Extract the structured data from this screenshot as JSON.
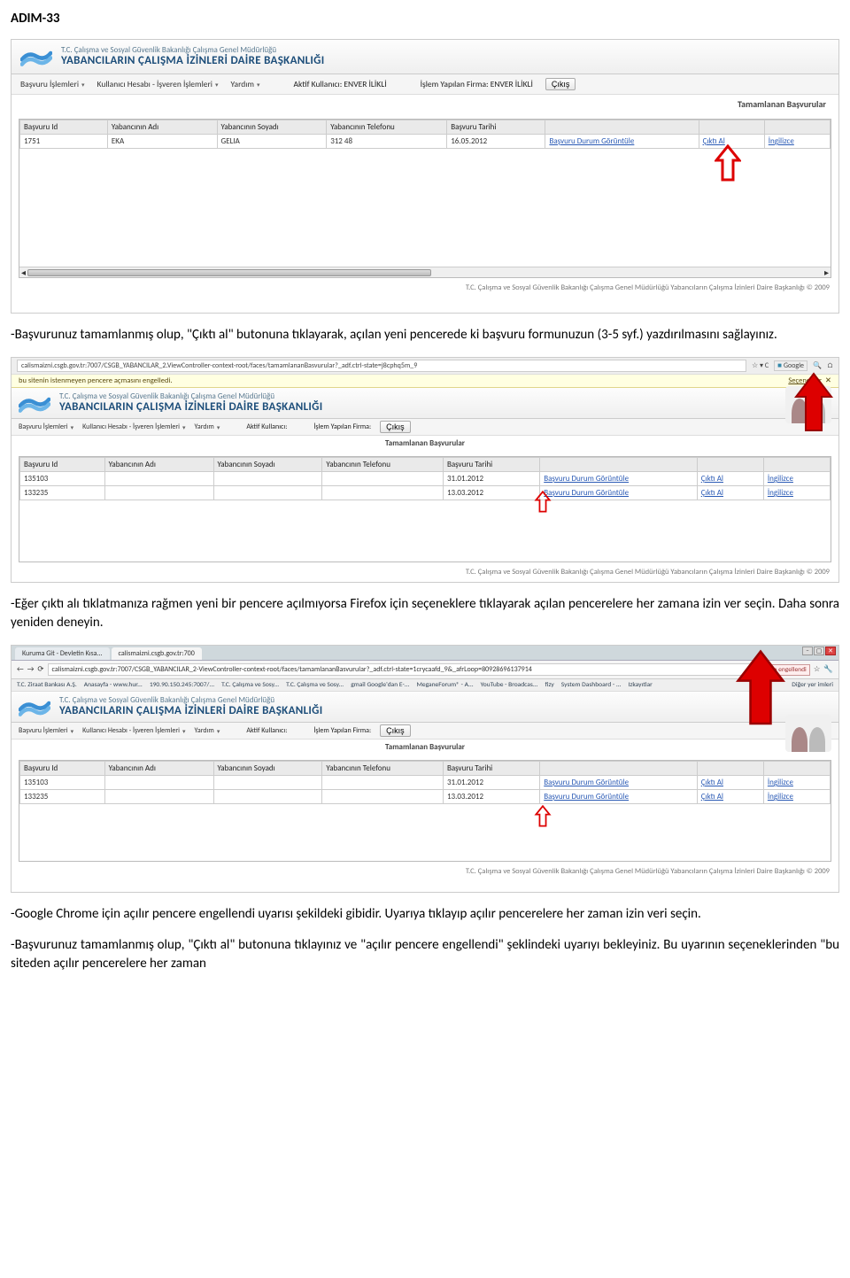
{
  "step": "ADIM-33",
  "p1": "-Başvurunuz tamamlanmış olup, \"Çıktı al\" butonuna tıklayarak, açılan yeni pencerede ki başvuru formunuzun (3-5 syf.) yazdırılmasını sağlayınız.",
  "p2": "-Eğer çıktı alı tıklatmanıza rağmen yeni bir pencere açılmıyorsa Firefox için seçeneklere tıklayarak açılan pencerelere her zamana izin ver seçin. Daha sonra yeniden deneyin.",
  "p3": "-Google Chrome için açılır pencere engellendi uyarısı şekildeki gibidir. Uyarıya tıklayıp açılır pencerelere her zaman izin veri seçin.",
  "p4": "-Başvurunuz tamamlanmış olup, \"Çıktı al\" butonuna tıklayınız ve \"açılır pencere engellendi\" şeklindeki uyarıyı bekleyiniz. Bu uyarının seçeneklerinden \"bu siteden açılır pencerelere her zaman",
  "app": {
    "ministry": "T.C. Çalışma ve Sosyal Güvenlik Bakanlığı Çalışma Genel Müdürlüğü",
    "dept": "YABANCILARIN ÇALIŞMA İZİNLERİ DAİRE BAŞKANLIĞI",
    "menu": {
      "m1": "Başvuru İşlemleri",
      "m2": "Kullanıcı Hesabı - İşveren İşlemleri",
      "m3": "Yardım"
    },
    "active_user_lbl": "Aktif Kullanıcı:",
    "active_user": "ENVER İLİKLİ",
    "firm_lbl": "İşlem Yapılan Firma:",
    "firm": "ENVER İLİKLİ",
    "exit": "Çıkış",
    "subheader": "Tamamlanan Başvurular",
    "footer": "T.C. Çalışma ve Sosyal Güvenlik Bakanlığı Çalışma Genel Müdürlüğü Yabancıların Çalışma İzinleri Daire Başkanlığı © 2009"
  },
  "tbl": {
    "h": {
      "id": "Başvuru Id",
      "ad": "Yabancının Adı",
      "soyad": "Yabancının Soyadı",
      "tel": "Yabancının Telefonu",
      "tarih": "Başvuru Tarihi"
    },
    "links": {
      "durum": "Başvuru Durum Görüntüle",
      "cikti": "Çıktı Al",
      "ing": "İngilizce"
    },
    "ss1row": {
      "id": "1751",
      "ad": "EKA",
      "soyad": "GELIA",
      "tel": "312 48",
      "tarih": "16.05.2012"
    },
    "ss2rows": [
      {
        "id": "135103",
        "tarih": "31.01.2012"
      },
      {
        "id": "133235",
        "tarih": "13.03.2012"
      }
    ],
    "ss3rows": [
      {
        "id": "135103",
        "tarih": "31.01.2012"
      },
      {
        "id": "133235",
        "tarih": "13.03.2012"
      }
    ]
  },
  "ff": {
    "url": "calismaizni.csgb.gov.tr:7007/CSGB_YABANCILAR_2.ViewController-context-root/faces/tamamlananBasvurular?_adf.ctrl-state=j8cphq5m_9",
    "blocked": "bu sitenin istenmeyen pencere açmasını engelledi.",
    "options": "Seçenekler",
    "google": "Google"
  },
  "chrome": {
    "tab1": "Kuruma Git - Devletin Kısa...",
    "tab2": "calismaizni.csgb.gov.tr:700",
    "url": "calismaizni.csgb.gov.tr:7007/CSGB_YABANCILAR_2-ViewController-context-root/faces/tamamlananBasvurular?_adf.ctrl-state=1crycaafd_9&_afrLoop=80928696137914",
    "popup": "Pop-up engellendi",
    "bm": [
      "T.C. Ziraat Bankası A.Ş.",
      "Anasayfa - www.hur...",
      "190.90.150.245:7007/...",
      "T.C. Çalışma ve Sosy...",
      "T.C. Çalışma ve Sosy...",
      "gmail Google'dan E-...",
      "MeganeForum® - A...",
      "YouTube - Broadcas...",
      "fizy",
      "System Dashboard - ...",
      "Izkayıtlar",
      "Diğer yer imleri"
    ]
  }
}
